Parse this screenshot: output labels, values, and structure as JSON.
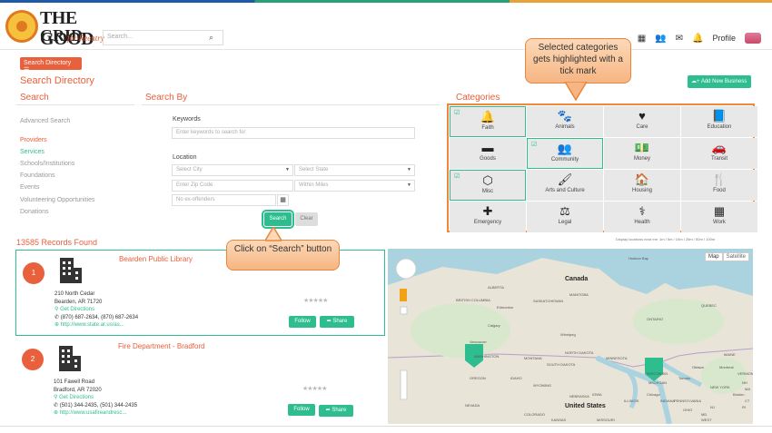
{
  "header": {
    "logo_line1": "THE GOOD",
    "logo_line2": "GRID",
    "logo_tagline": "for Reentry",
    "search_placeholder": "Search...",
    "profile_label": "Profile"
  },
  "search_directory_button": "Search Directory",
  "page_title": "Search Directory",
  "add_business_button": "+ Add New Business",
  "sections": {
    "search": "Search",
    "search_by": "Search By",
    "categories": "Categories"
  },
  "sidebar": {
    "items": [
      {
        "label": "Advanced Search"
      },
      {
        "label": "Providers"
      },
      {
        "label": "Services"
      },
      {
        "label": "Schools/Institutions"
      },
      {
        "label": "Foundations"
      },
      {
        "label": "Events"
      },
      {
        "label": "Volunteering Opportunities"
      },
      {
        "label": "Donations"
      }
    ]
  },
  "form": {
    "keywords_label": "Keywords",
    "keywords_placeholder": "Enter keywords to search for",
    "location_label": "Location",
    "city_placeholder": "Select City",
    "state_placeholder": "Select State",
    "zip_placeholder": "Enter Zip Code",
    "miles_placeholder": "Within Miles",
    "offenders_placeholder": "No ex-offenders",
    "search_button": "Search",
    "clear_button": "Clear"
  },
  "categories": [
    {
      "label": "Faith",
      "icon": "bell-icon",
      "glyph": "🔔",
      "selected": true
    },
    {
      "label": "Animals",
      "icon": "paw-icon",
      "glyph": "🐾",
      "selected": false
    },
    {
      "label": "Care",
      "icon": "heart-icon",
      "glyph": "♥",
      "selected": false
    },
    {
      "label": "Education",
      "icon": "book-icon",
      "glyph": "📘",
      "selected": false
    },
    {
      "label": "Goods",
      "icon": "box-icon",
      "glyph": "▬",
      "selected": false
    },
    {
      "label": "Community",
      "icon": "people-icon",
      "glyph": "👥",
      "selected": true
    },
    {
      "label": "Money",
      "icon": "money-icon",
      "glyph": "💵",
      "selected": false
    },
    {
      "label": "Transit",
      "icon": "car-icon",
      "glyph": "🚗",
      "selected": false
    },
    {
      "label": "Misc",
      "icon": "cube-icon",
      "glyph": "⬡",
      "selected": true
    },
    {
      "label": "Arts and Culture",
      "icon": "brush-icon",
      "glyph": "🖌",
      "selected": false
    },
    {
      "label": "Housing",
      "icon": "home-icon",
      "glyph": "🏠",
      "selected": false
    },
    {
      "label": "Food",
      "icon": "utensils-icon",
      "glyph": "🍴",
      "selected": false
    },
    {
      "label": "Emergency",
      "icon": "medkit-icon",
      "glyph": "✚",
      "selected": false
    },
    {
      "label": "Legal",
      "icon": "gavel-icon",
      "glyph": "⚖",
      "selected": false
    },
    {
      "label": "Health",
      "icon": "stethoscope-icon",
      "glyph": "⚕",
      "selected": false
    },
    {
      "label": "Work",
      "icon": "building-icon",
      "glyph": "▦",
      "selected": false
    }
  ],
  "records_found": "13585 Records Found",
  "display_note": "Display locations near me: 1m / 5m / 10m / 25m / 50m / 100m",
  "results": [
    {
      "number": "1",
      "title": "Bearden Public Library",
      "address1": "210 North Cedar",
      "address2": "Bearden, AR 71720",
      "directions": "Get Directions",
      "phone": "(870) 687-2634, (870) 687-2634",
      "website": "http://www.state.ar.us/as...",
      "follow": "Follow",
      "share": "Share"
    },
    {
      "number": "2",
      "title": "Fire Department - Bradford",
      "address1": "101 Fawell Road",
      "address2": "Bradford, AR 72020",
      "directions": "Get Directions",
      "phone": "(501) 344-2435, (501) 344-2435",
      "website": "http://www.usafireandresc...",
      "follow": "Follow",
      "share": "Share"
    }
  ],
  "map": {
    "map_button": "Map",
    "satellite_button": "Satellite",
    "labels": [
      "Canada",
      "ALBERTA",
      "BRITISH COLUMBIA",
      "SASKATCHEWAN",
      "MANITOBA",
      "ONTARIO",
      "QUEBEC",
      "Edmonton",
      "Calgary",
      "Vancouver",
      "Winnipeg",
      "Hudson Bay",
      "NORTH DAKOTA",
      "MINNESOTA",
      "MONTANA",
      "OREGON",
      "IDAHO",
      "WYOMING",
      "NEBRASKA",
      "IOWA",
      "NEVADA",
      "WISCONSIN",
      "MICHIGAN",
      "Chicago",
      "ILLINOIS",
      "INDIANA",
      "United States",
      "KANSAS",
      "MISSOURI",
      "Toronto",
      "Ottawa",
      "Montreal",
      "NEW YORK",
      "PENNSYLVANIA",
      "MAINE",
      "VERMONT",
      "Boston",
      "NH",
      "MA",
      "CT",
      "RI",
      "NJ",
      "MD",
      "OHIO",
      "WEST",
      "COLORADO",
      "SOUTH DAKOTA",
      "WASHINGTON"
    ]
  },
  "annotations": {
    "categories_note": "Selected categories gets highlighted with a tick mark",
    "search_note": "Click on “Search” button"
  }
}
